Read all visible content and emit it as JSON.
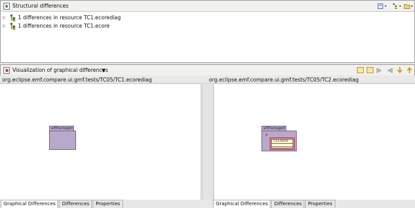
{
  "structural_view": {
    "title": "Structural differences",
    "icon": "compare-view-icon",
    "toolbar_icons": [
      "merge-dropdown-icon",
      "filter-dropdown-icon",
      "folder-dropdown-icon"
    ],
    "tree": [
      {
        "label": "1 differences in resource TC1.ecorediag",
        "icon": "diff-tree-icon"
      },
      {
        "label": "1 differences in resource TC1.ecore",
        "icon": "diff-tree-icon"
      }
    ]
  },
  "visualization_view": {
    "title": "Visualization of graphical differences",
    "icon": "graphical-diff-view-icon",
    "menu_icon": "view-menu-triangle-icon",
    "toolbar_icons": [
      "copy-left-icon",
      "copy-right-icon",
      "copy-all-right-icon",
      "copy-all-left-icon",
      "next-diff-icon",
      "prev-diff-icon"
    ]
  },
  "left_pane": {
    "path": "org.eclipse.emf.compare.ui.gmf.tests/TC05/TC1.ecorediag",
    "package_label": "EPackage0",
    "tabs": [
      "Graphical Differences",
      "Differences",
      "Properties"
    ],
    "active_tab": 0
  },
  "right_pane": {
    "path": "org.eclipse.emf.compare.ui.gmf.tests/TC05/TC2.ecorediag",
    "package_label": "EPackage0",
    "class_label": "EClass0",
    "tabs": [
      "Graphical Differences",
      "Differences",
      "Properties"
    ],
    "active_tab": 0
  },
  "colors": {
    "package_fill": "#b8a8c9",
    "highlight": "#d1205f",
    "class_fill": "#fffbe0"
  }
}
